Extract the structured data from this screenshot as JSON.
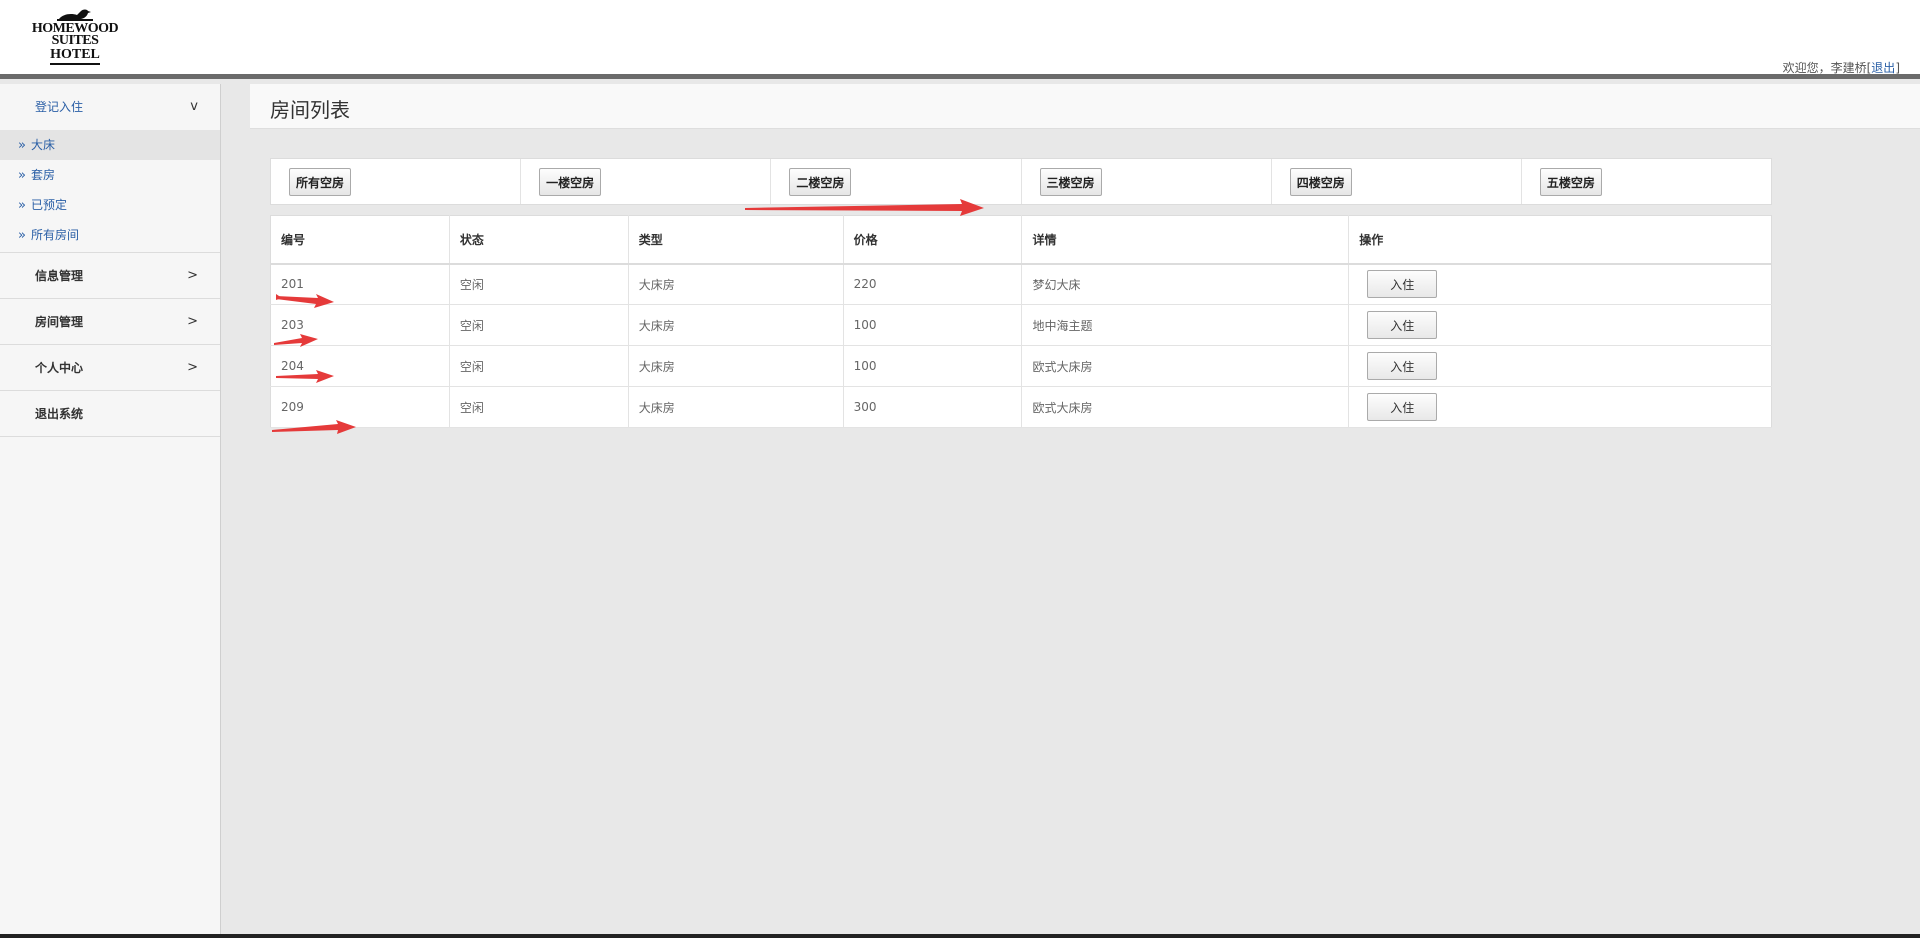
{
  "header": {
    "logo_line1": "HOMEWOOD",
    "logo_line2": "SUITES",
    "logo_line3": "HOTEL",
    "welcome_prefix": "欢迎您，李建桥[",
    "logout_label": "退出",
    "welcome_suffix": "]"
  },
  "sidebar": {
    "groups": [
      {
        "label": "登记入住",
        "arrow": "v",
        "open": true
      },
      {
        "label": "信息管理",
        "arrow": ">"
      },
      {
        "label": "房间管理",
        "arrow": ">"
      },
      {
        "label": "个人中心",
        "arrow": ">"
      },
      {
        "label": "退出系统",
        "arrow": ""
      }
    ],
    "sub_items": [
      {
        "label": "大床",
        "active": true
      },
      {
        "label": "套房"
      },
      {
        "label": "已预定"
      },
      {
        "label": "所有房间"
      }
    ],
    "chevron": "»"
  },
  "main": {
    "title": "房间列表",
    "filters": [
      "所有空房",
      "一楼空房",
      "二楼空房",
      "三楼空房",
      "四楼空房",
      "五楼空房"
    ],
    "table": {
      "headers": [
        "编号",
        "状态",
        "类型",
        "价格",
        "详情",
        "操作"
      ],
      "rows": [
        {
          "id": "201",
          "status": "空闲",
          "type": "大床房",
          "price": "220",
          "detail": "梦幻大床",
          "action": "入住"
        },
        {
          "id": "203",
          "status": "空闲",
          "type": "大床房",
          "price": "100",
          "detail": "地中海主题",
          "action": "入住"
        },
        {
          "id": "204",
          "status": "空闲",
          "type": "大床房",
          "price": "100",
          "detail": "欧式大床房",
          "action": "入住"
        },
        {
          "id": "209",
          "status": "空闲",
          "type": "大床房",
          "price": "300",
          "detail": "欧式大床房",
          "action": "入住"
        }
      ]
    }
  },
  "colors": {
    "accent": "#2a5fa6",
    "annotation_arrow": "#e53a3a",
    "header_border": "#6b6b6b",
    "background": "#e8e8e8"
  }
}
